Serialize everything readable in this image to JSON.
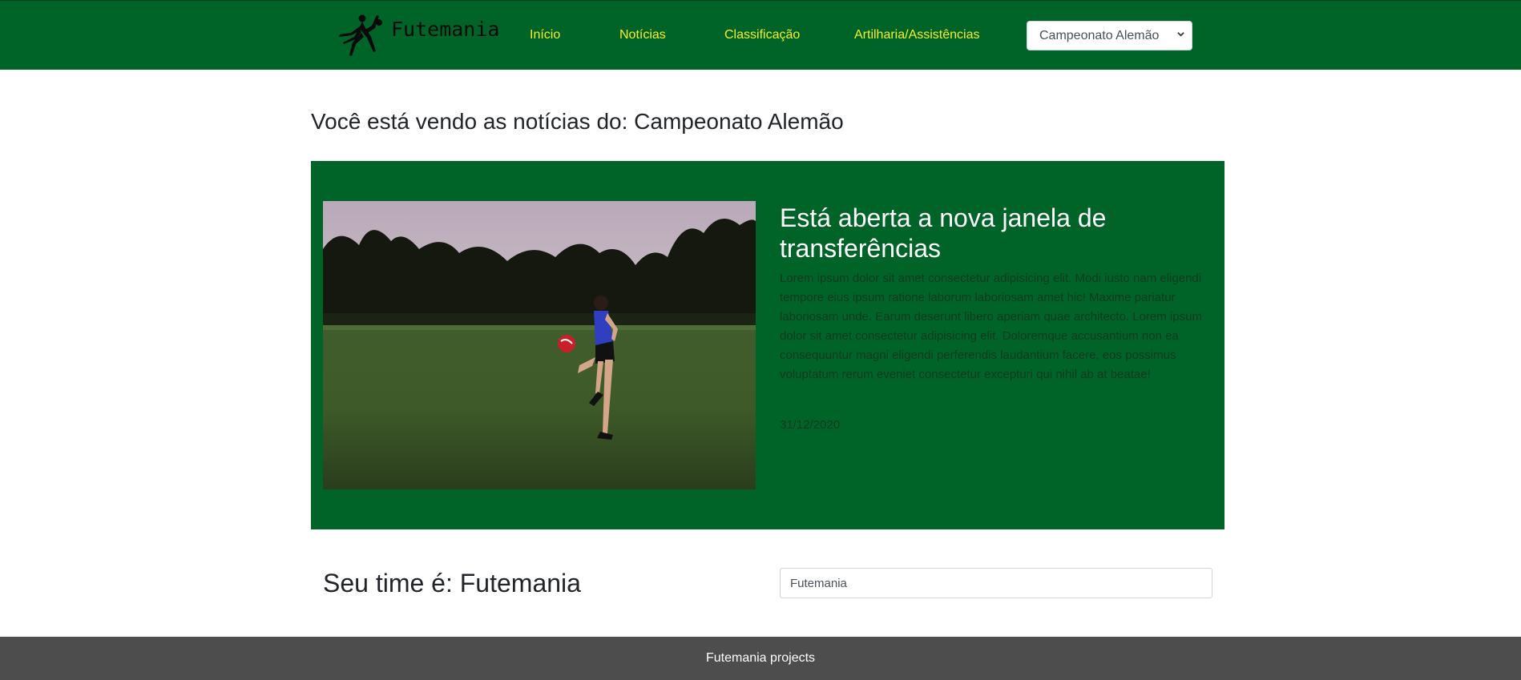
{
  "brand": {
    "name": "Futemania",
    "logo_icon": "bicycle-kick-player-icon"
  },
  "nav": {
    "items": [
      {
        "label": "Início"
      },
      {
        "label": "Notícias"
      },
      {
        "label": "Classificação"
      },
      {
        "label": "Artilharia/Assistências"
      }
    ],
    "league_select": {
      "selected": "Campeonato Alemão",
      "icon": "chevron-down-icon"
    }
  },
  "main": {
    "heading": "Você está vendo as notícias do: Campeonato Alemão",
    "news": {
      "image": "soccer-player-juggling-ball-photo",
      "title": "Está aberta a nova janela de transferências",
      "body": "Lorem ipsum dolor sit amet consectetur adipisicing elit. Modi iusto nam eligendi tempore eius ipsum ratione laborum laboriosam amet hic! Maxime pariatur laboriosam unde. Earum deserunt libero aperiam quae architecto. Lorem ipsum dolor sit amet consectetur adipisicing elit. Doloremque accusantium non ea consequuntur magni eligendi perferendis laudantium facere, eos possimus voluptatum rerum eveniet consectetur excepturi qui nihil ab at beatae!",
      "date": "31/12/2020"
    },
    "team": {
      "heading": "Seu time é: Futemania",
      "input_value": "Futemania"
    }
  },
  "footer": {
    "text": "Futemania projects"
  },
  "colors": {
    "primary_green": "#006428",
    "nav_link_yellow": "#f7ee2b",
    "footer_gray": "#4d4d4d"
  }
}
